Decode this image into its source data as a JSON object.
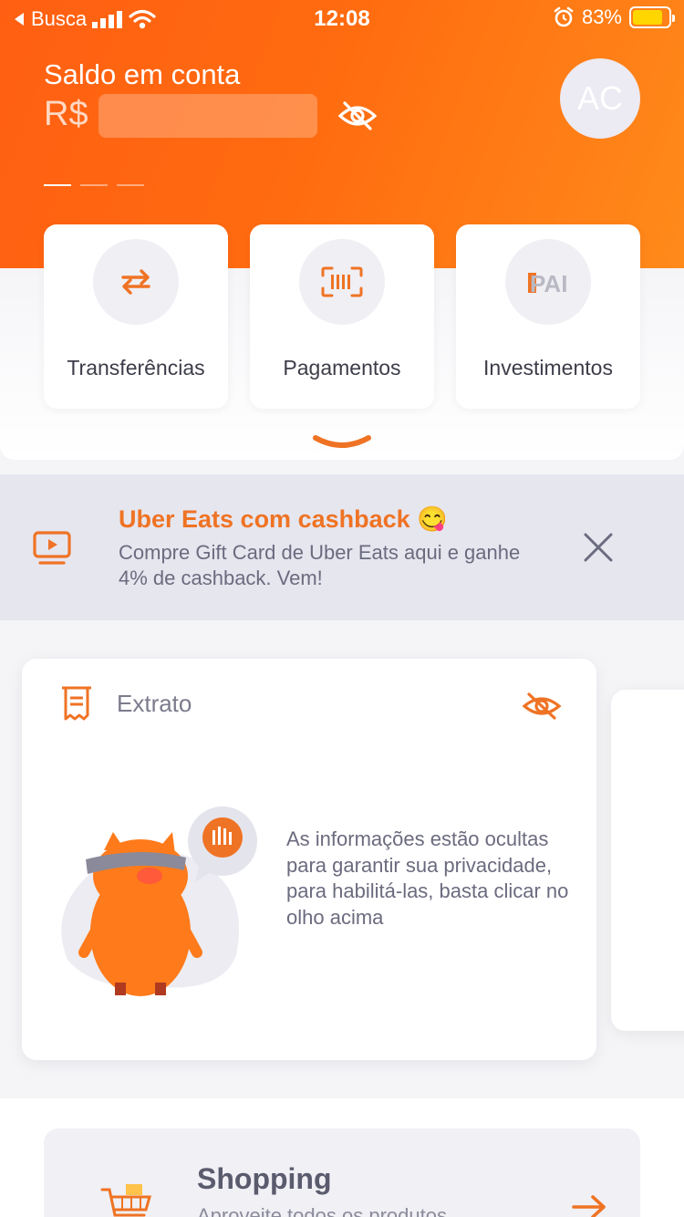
{
  "status_bar": {
    "back_app": "Busca",
    "time": "12:08",
    "battery_percent": "83%",
    "battery_level": 0.83
  },
  "balance": {
    "label": "Saldo em conta",
    "currency": "R$",
    "hidden": true
  },
  "profile": {
    "initials": "AC"
  },
  "carousel": {
    "pages": 3,
    "active_index": 0
  },
  "shortcuts": [
    {
      "label": "Transferências",
      "icon": "transfer-arrows-icon"
    },
    {
      "label": "Pagamentos",
      "icon": "barcode-scan-icon"
    },
    {
      "label": "Investimentos",
      "icon": "pai-logo-icon",
      "logo_text": "PAI"
    }
  ],
  "promo": {
    "title": "Uber Eats com cashback",
    "emoji": "😋",
    "text": "Compre Gift Card de Uber Eats aqui e ganhe 4% de cashback. Vem!",
    "icon": "video-icon"
  },
  "extrato": {
    "title": "Extrato",
    "hidden_message": "As informações estão ocultas para garantir sua privacidade, para habilitá-las, basta clicar no olho acima"
  },
  "shopping": {
    "title": "Shopping",
    "subtitle": "Aproveite todos os produtos",
    "icon": "shopping-cart-icon"
  },
  "colors": {
    "accent": "#EF7324",
    "header_start": "#FF5F12",
    "header_end": "#FF8A1A",
    "text_muted": "#6B6B7F",
    "battery": "#FFD600"
  }
}
